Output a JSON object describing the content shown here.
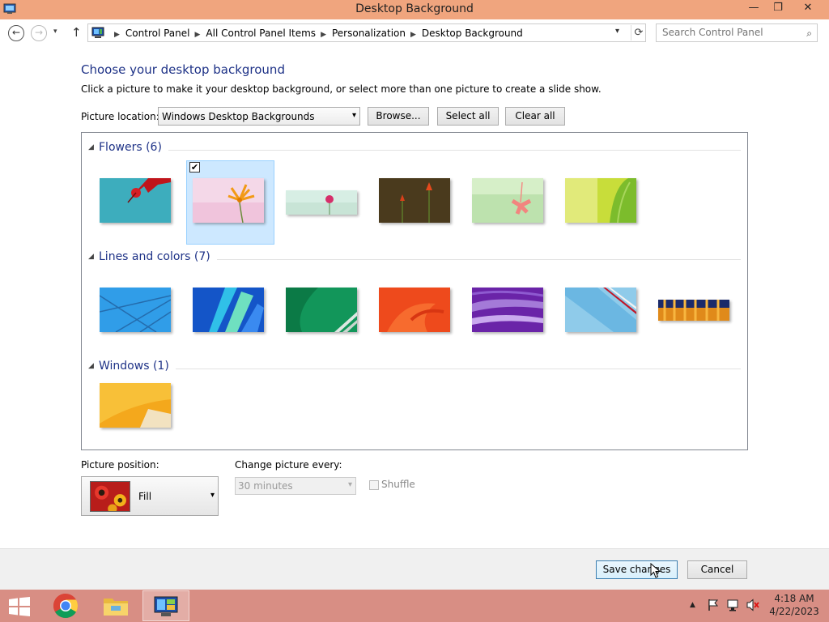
{
  "window": {
    "title": "Desktop Background",
    "minimize": "—",
    "restore": "❐",
    "close": "✕"
  },
  "nav": {
    "back": "←",
    "forward": "→",
    "dropdown": "▾",
    "up": "↑",
    "breadcrumbs": [
      "Control Panel",
      "All Control Panel Items",
      "Personalization",
      "Desktop Background"
    ],
    "separator": "▶",
    "address_dropdown": "▾",
    "refresh": "⟳",
    "search_placeholder": "Search Control Panel",
    "search_icon": "⌕"
  },
  "content": {
    "heading": "Choose your desktop background",
    "subtext": "Click a picture to make it your desktop background, or select more than one picture to create a slide show.",
    "picture_location_label": "Picture location:",
    "picture_location_value": "Windows Desktop Backgrounds",
    "dropdown_arrow": "▾",
    "browse_label": "Browse...",
    "select_all_label": "Select all",
    "clear_all_label": "Clear all"
  },
  "gallery": {
    "collapse_glyph": "◢",
    "groups": [
      {
        "title": "Flowers (6)",
        "count": 6,
        "selected_index": 1
      },
      {
        "title": "Lines and colors (7)",
        "count": 7
      },
      {
        "title": "Windows (1)",
        "count": 1
      }
    ],
    "checkmark": "✔"
  },
  "options": {
    "picture_position_label": "Picture position:",
    "picture_position_value": "Fill",
    "change_picture_label": "Change picture every:",
    "change_picture_value": "30 minutes",
    "shuffle_label": "Shuffle",
    "shuffle_checked": false
  },
  "footer": {
    "save_label": "Save changes",
    "cancel_label": "Cancel"
  },
  "taskbar": {
    "time": "4:18 AM",
    "date": "4/22/2023",
    "tray_up": "▲"
  },
  "colors": {
    "title_bar": "#f0a57e",
    "taskbar": "#d88e84",
    "heading": "#1e3287",
    "selection": "#cde8ff"
  }
}
